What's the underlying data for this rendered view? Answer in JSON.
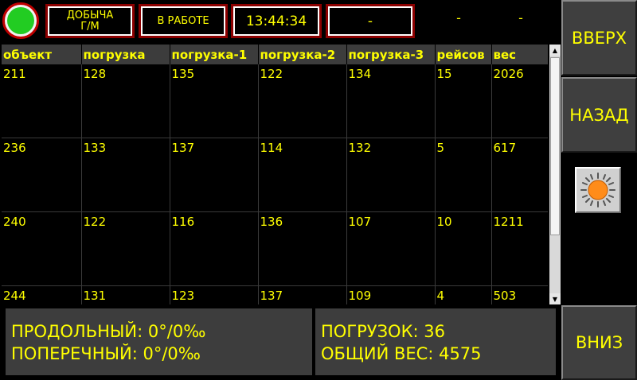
{
  "status": {
    "mode_label": "ДОБЫЧА\nГ/М",
    "state_label": "В РАБОТЕ",
    "clock": "13:44:34",
    "field_value": "-",
    "dash_1": "-",
    "dash_2": "-",
    "indicator_color": "#22cc22"
  },
  "table": {
    "columns": [
      "объект",
      "погрузка",
      "погрузка-1",
      "погрузка-2",
      "погрузка-3",
      "рейсов",
      "вес"
    ],
    "rows": [
      [
        "211",
        "128",
        "135",
        "122",
        "134",
        "15",
        "2026"
      ],
      [
        "236",
        "133",
        "137",
        "114",
        "132",
        "5",
        "617"
      ],
      [
        "240",
        "122",
        "116",
        "136",
        "107",
        "10",
        "1211"
      ],
      [
        "244",
        "131",
        "123",
        "137",
        "109",
        "4",
        "503"
      ]
    ]
  },
  "buttons": {
    "up": "ВВЕРХ",
    "back": "НАЗАД",
    "down": "ВНИЗ",
    "brightness_icon": "sun-icon"
  },
  "bottom": {
    "longitudinal": "ПРОДОЛЬНЫЙ: 0°/0‰",
    "transverse": "ПОПЕРЕЧНЫЙ: 0°/0‰",
    "loads": "ПОГРУЗОК: 36",
    "total_weight": "ОБЩИЙ ВЕС: 4575"
  },
  "colors": {
    "text": "#ffff00",
    "background": "#000000",
    "panel": "#3d3d3d",
    "frame": "#8c0000"
  }
}
